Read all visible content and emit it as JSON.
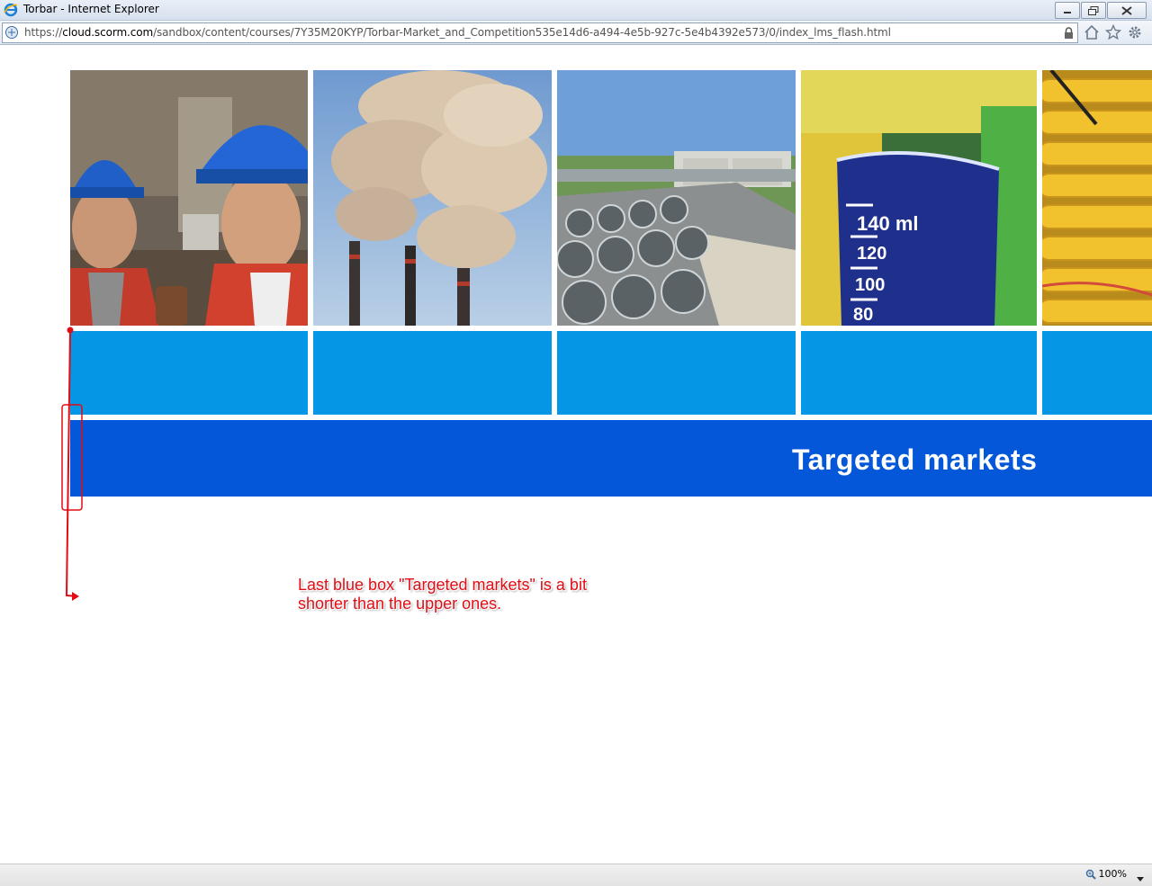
{
  "window": {
    "title": "Torbar - Internet Explorer"
  },
  "address": {
    "url_prefix": "https://",
    "url_host": "cloud.scorm.com",
    "url_path": "/sandbox/content/courses/7Y35M20KYP/Torbar-Market_and_Competition535e14d6-a494-4e5b-927c-5e4b4392e573/0/index_lms_flash.html"
  },
  "content": {
    "banner_title": "Targeted markets",
    "annotation": "Last blue box \"Targeted markets\" is a bit shorter than the upper ones."
  },
  "statusbar": {
    "zoom": "100%"
  },
  "colors": {
    "tile_blue": "#0596e6",
    "banner_blue": "#0457d9",
    "annotation_red": "#e10c14"
  },
  "icons": [
    "ie-logo-icon",
    "minimize-icon",
    "restore-icon",
    "close-icon",
    "page-icon",
    "lock-icon",
    "home-icon",
    "favorites-star-icon",
    "settings-gear-icon",
    "zoom-icon",
    "dropdown-arrow-icon"
  ]
}
